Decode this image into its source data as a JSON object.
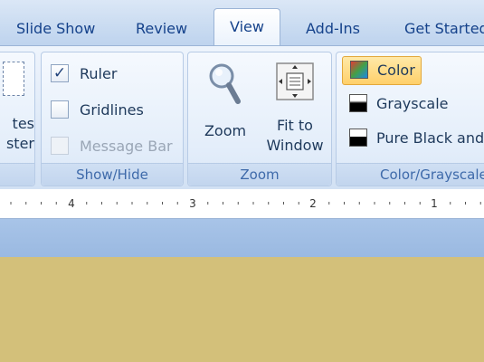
{
  "tabs": [
    {
      "label": "Slide Show",
      "active": false
    },
    {
      "label": "Review",
      "active": false
    },
    {
      "label": "View",
      "active": true
    },
    {
      "label": "Add-Ins",
      "active": false
    },
    {
      "label": "Get Started",
      "active": false
    }
  ],
  "groups": {
    "notes_master": {
      "line1": "tes",
      "line2": "ster"
    },
    "show_hide": {
      "label": "Show/Hide",
      "items": [
        {
          "label": "Ruler",
          "checked": true,
          "enabled": true
        },
        {
          "label": "Gridlines",
          "checked": false,
          "enabled": true
        },
        {
          "label": "Message Bar",
          "checked": false,
          "enabled": false
        }
      ]
    },
    "zoom": {
      "label": "Zoom",
      "zoom_button": "Zoom",
      "fit_line1": "Fit to",
      "fit_line2": "Window",
      "zoom_icon": "magnifier-icon",
      "fit_icon": "fit-to-window-icon"
    },
    "color_grayscale": {
      "label": "Color/Grayscale",
      "items": [
        {
          "label": "Color",
          "selected": true
        },
        {
          "label": "Grayscale",
          "selected": false
        },
        {
          "label": "Pure Black and White",
          "selected": false
        }
      ]
    }
  },
  "ruler": {
    "ticks": [
      "4",
      "3",
      "2",
      "1"
    ]
  },
  "colors": {
    "tab_text": "#15428b",
    "ribbon_bg": "#dfeaf8",
    "group_label": "#3e6aaa",
    "active_highlight": "#ffd06a",
    "slide_background": "#d3c07a"
  }
}
